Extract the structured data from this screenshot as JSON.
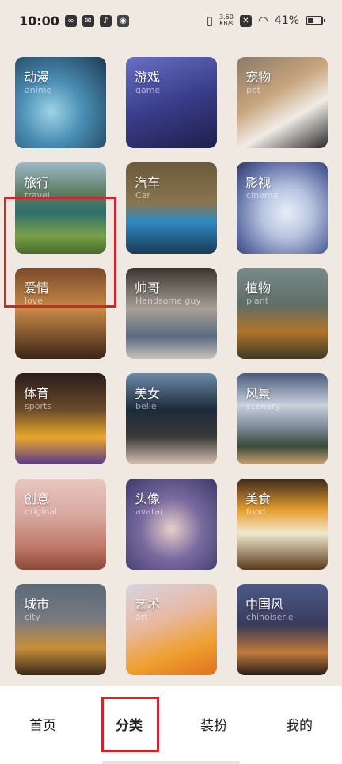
{
  "status_bar": {
    "time": "10:00",
    "net_speed_value": "3.60",
    "net_speed_unit": "KB/s",
    "battery": "41%"
  },
  "categories": [
    {
      "title": "动漫",
      "subtitle": "anime"
    },
    {
      "title": "游戏",
      "subtitle": "game"
    },
    {
      "title": "宠物",
      "subtitle": "pet"
    },
    {
      "title": "旅行",
      "subtitle": "travel"
    },
    {
      "title": "汽车",
      "subtitle": "Car"
    },
    {
      "title": "影视",
      "subtitle": "cinema"
    },
    {
      "title": "爱情",
      "subtitle": "love"
    },
    {
      "title": "帅哥",
      "subtitle": "Handsome guy"
    },
    {
      "title": "植物",
      "subtitle": "plant"
    },
    {
      "title": "体育",
      "subtitle": "sports"
    },
    {
      "title": "美女",
      "subtitle": "belle"
    },
    {
      "title": "风景",
      "subtitle": "scenery"
    },
    {
      "title": "创意",
      "subtitle": "original"
    },
    {
      "title": "头像",
      "subtitle": "avatar"
    },
    {
      "title": "美食",
      "subtitle": "food"
    },
    {
      "title": "城市",
      "subtitle": "city"
    },
    {
      "title": "艺术",
      "subtitle": "art"
    },
    {
      "title": "中国风",
      "subtitle": "chinoiserie"
    }
  ],
  "bottom_nav": {
    "items": [
      {
        "label": "首页"
      },
      {
        "label": "分类"
      },
      {
        "label": "装扮"
      },
      {
        "label": "我的"
      }
    ],
    "active_index": 1
  }
}
